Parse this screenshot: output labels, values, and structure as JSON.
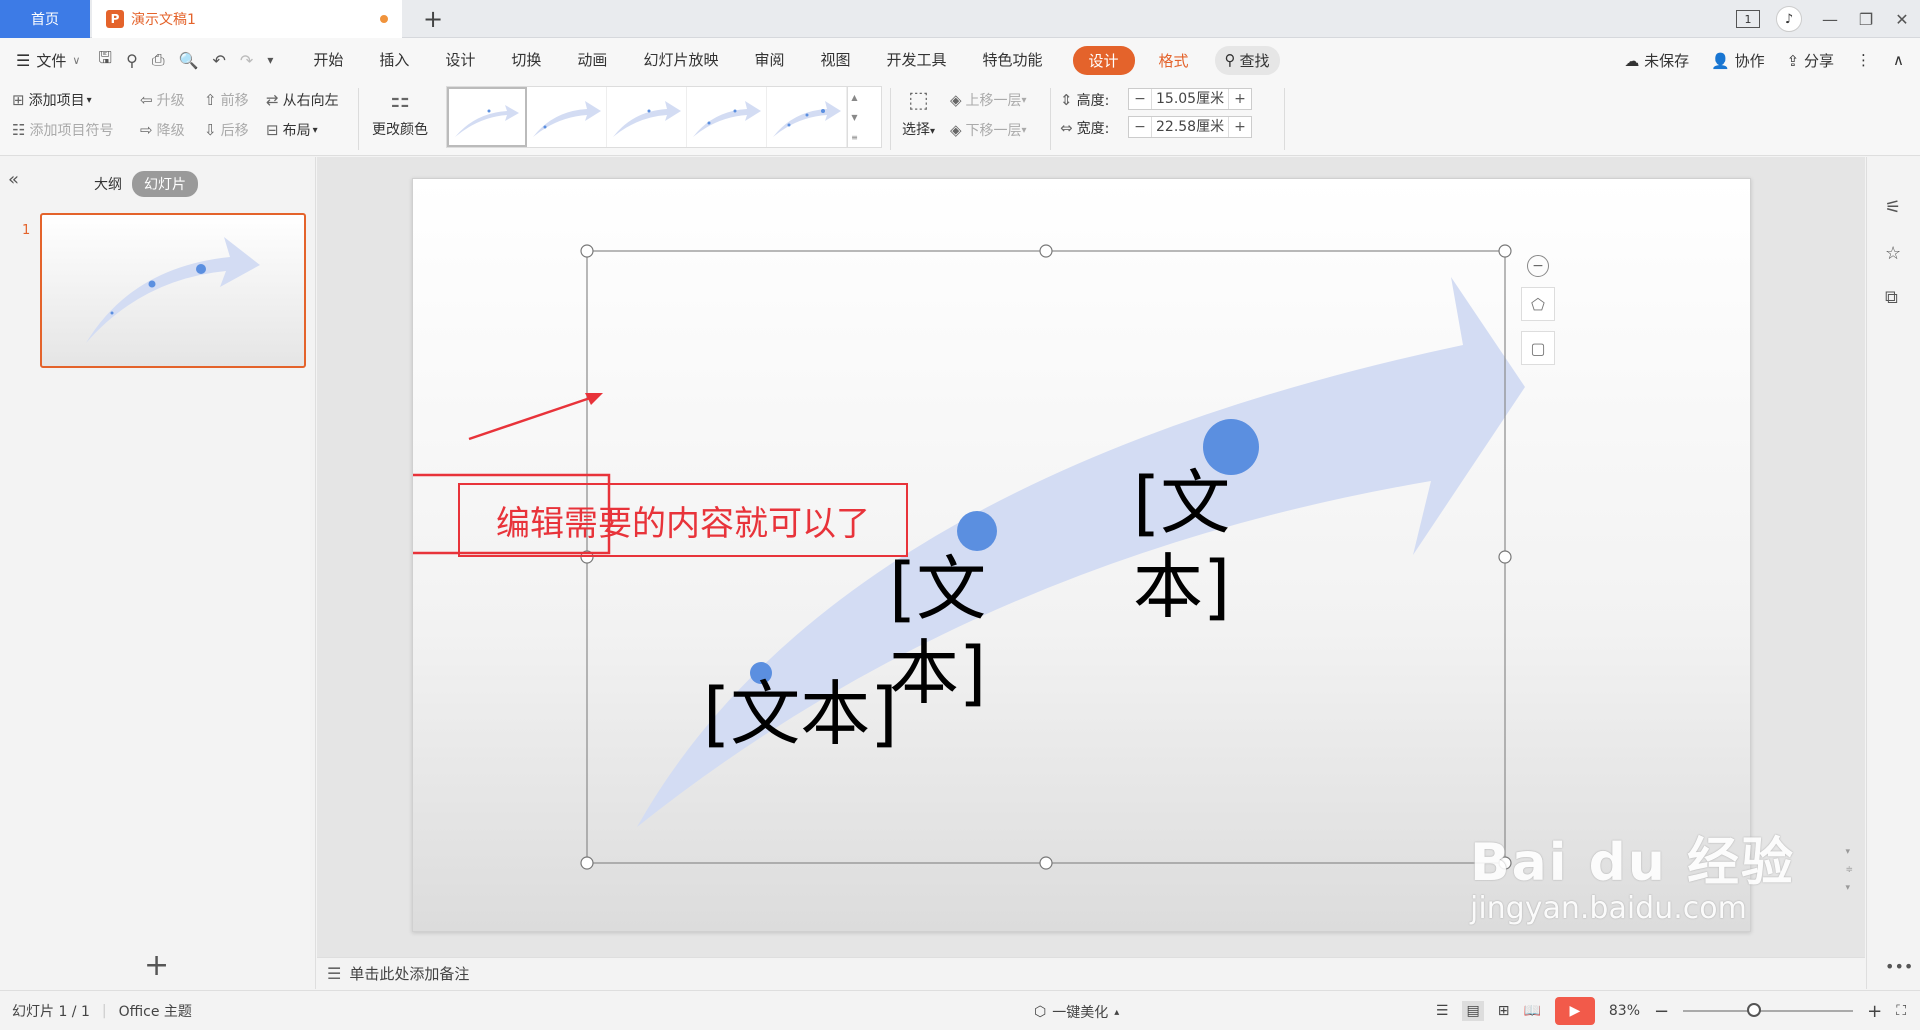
{
  "titlebar": {
    "home_tab": "首页",
    "doc_tab": "演示文稿1",
    "doc_logo": "P",
    "new_tab": "+",
    "badge": "1"
  },
  "menubar": {
    "file": "文件",
    "items": [
      "开始",
      "插入",
      "设计",
      "切换",
      "动画",
      "幻灯片放映",
      "审阅",
      "视图",
      "开发工具",
      "特色功能"
    ],
    "active_tab": "设计",
    "format_tab": "格式",
    "search": "查找",
    "right": {
      "unsaved": "未保存",
      "collab": "协作",
      "share": "分享"
    }
  },
  "ribbon": {
    "add_item": "添加项目",
    "add_bullet": "添加项目符号",
    "upgrade": "升级",
    "downgrade": "降级",
    "forward": "前移",
    "backward": "后移",
    "rtl": "从右向左",
    "layout": "布局",
    "change_color": "更改颜色",
    "select": "选择",
    "bring_forward": "上移一层",
    "send_backward": "下移一层",
    "height_label": "高度:",
    "height_value": "15.05厘米",
    "width_label": "宽度:",
    "width_value": "22.58厘米"
  },
  "leftpanel": {
    "outline_tab": "大纲",
    "slides_tab": "幻灯片",
    "slide_number": "1"
  },
  "slide": {
    "callout": "编辑需要的内容就可以了",
    "text1": "[文本]",
    "text2_line1": "[文",
    "text2_line2": "本]",
    "text3_line1": "[文",
    "text3_line2": "本]",
    "colors": {
      "arrow": "#d3dcf3",
      "dot": "#5b8fe0",
      "callout": "#e8333a"
    }
  },
  "notes": {
    "placeholder": "单击此处添加备注"
  },
  "statusbar": {
    "slide_info": "幻灯片 1 / 1",
    "theme": "Office 主题",
    "beautify": "一键美化",
    "zoom": "83%"
  },
  "watermark": {
    "brand": "Bai du 经验",
    "url": "jingyan.baidu.com"
  }
}
